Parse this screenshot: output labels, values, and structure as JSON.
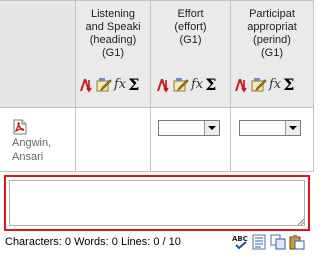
{
  "columns": [
    {
      "lines": [
        "Listening",
        "and Speaki",
        "(heading)",
        "(G1)"
      ]
    },
    {
      "lines": [
        "Effort",
        "(effort)",
        "(G1)"
      ]
    },
    {
      "lines": [
        "Participat",
        "appropriat",
        "(perind)",
        "(G1)"
      ]
    }
  ],
  "column_icons": [
    "sort-icon",
    "edit-icon",
    "fx-icon",
    "sum-icon"
  ],
  "fx_symbol": "fx",
  "sum_symbol": "Σ",
  "student": {
    "name_line1": "Angwin,",
    "name_line2": "Ansari",
    "icon": "pdf-document-icon"
  },
  "selects": [
    {
      "value": ""
    },
    {
      "value": ""
    }
  ],
  "comment": {
    "value": "",
    "border_color": "#e0141c"
  },
  "counter": {
    "text": "Characters: 0 Words: 0 Lines: 0 /  10"
  },
  "toolbar": [
    {
      "icon": "spellcheck-icon",
      "label": "ABC"
    },
    {
      "icon": "list-icon"
    },
    {
      "icon": "copy-icon"
    },
    {
      "icon": "paste-icon"
    }
  ]
}
